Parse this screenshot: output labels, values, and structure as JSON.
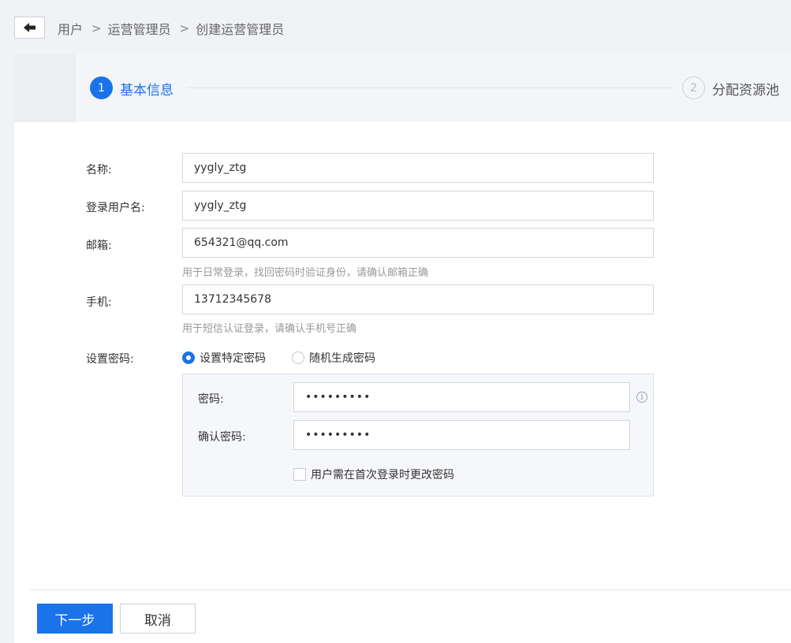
{
  "breadcrumb": {
    "items": [
      "用户",
      "运营管理员",
      "创建运营管理员"
    ],
    "separator": ">"
  },
  "steps": [
    {
      "number": "1",
      "label": "基本信息",
      "active": true
    },
    {
      "number": "2",
      "label": "分配资源池",
      "active": false
    }
  ],
  "form": {
    "name": {
      "label": "名称:",
      "value": "yygly_ztg"
    },
    "username": {
      "label": "登录用户名:",
      "value": "yygly_ztg"
    },
    "email": {
      "label": "邮箱:",
      "value": "654321@qq.com",
      "hint": "用于日常登录，找回密码时验证身份，请确认邮箱正确"
    },
    "phone": {
      "label": "手机:",
      "value": "13712345678",
      "hint": "用于短信认证登录，请确认手机号正确"
    },
    "password_mode": {
      "label": "设置密码:",
      "options": [
        "设置特定密码",
        "随机生成密码"
      ],
      "selected": "设置特定密码"
    },
    "password": {
      "label": "密码:",
      "value": "•••••••••"
    },
    "confirm_password": {
      "label": "确认密码:",
      "value": "•••••••••"
    },
    "force_change": {
      "label": "用户需在首次登录时更改密码",
      "checked": false
    }
  },
  "actions": {
    "next": "下一步",
    "cancel": "取消"
  },
  "colors": {
    "primary": "#1a73e8",
    "background": "#f0f2f5"
  },
  "icons": {
    "back": "arrow-left-icon",
    "info": "info-icon"
  }
}
